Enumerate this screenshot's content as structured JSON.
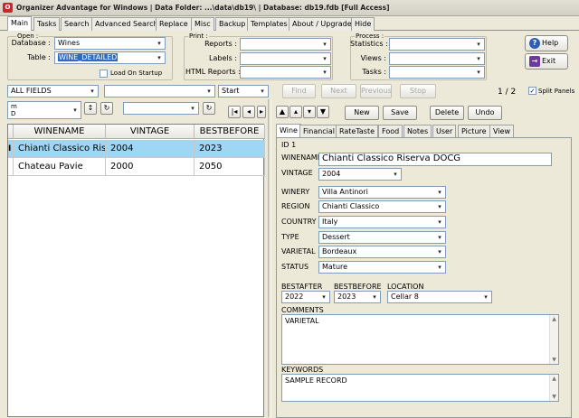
{
  "window": {
    "title": "Organizer Advantage for Windows | Data Folder: ...\\data\\db19\\ | Database: db19.fdb [Full Access]"
  },
  "main_tabs": [
    "Main",
    "Tasks",
    "Search",
    "Advanced Search",
    "Replace",
    "Misc",
    "Backup",
    "Templates",
    "About / Upgrade",
    "Hide"
  ],
  "open_group": {
    "label": "Open :",
    "database_label": "Database :",
    "database_value": "Wines",
    "table_label": "Table :",
    "table_value": "WINE_DETAILED",
    "load_on_startup_label": "Load On Startup",
    "load_on_startup_checked": false
  },
  "print_group": {
    "label": "Print :",
    "reports_label": "Reports :",
    "labels_label": "Labels :",
    "html_reports_label": "HTML Reports :"
  },
  "process_group": {
    "label": "Process :",
    "statistics_label": "Statistics :",
    "views_label": "Views :",
    "tasks_label": "Tasks :"
  },
  "side_buttons": {
    "help": "Help",
    "exit": "Exit"
  },
  "search_bar": {
    "field": "ALL FIELDS",
    "value": "",
    "mode": "Start",
    "find": "Find",
    "next": "Next",
    "previous": "Previous",
    "stop": "Stop",
    "record_counter": "1 / 2",
    "split_panels_label": "Split Panels",
    "split_panels_checked": true
  },
  "sort_bar": {
    "sort_field_line1": "m",
    "sort_field_line2": "D"
  },
  "grid": {
    "columns": [
      "WINENAME",
      "VINTAGE",
      "BESTBEFORE"
    ],
    "row_indicator": "I",
    "rows": [
      [
        "Chianti Classico Riserva DOCG",
        "2004",
        "2023"
      ],
      [
        "Chateau Pavie",
        "2000",
        "2050"
      ]
    ],
    "selected_row": 0
  },
  "record_toolbar": {
    "nav_icons": [
      "first-icon",
      "prior-icon",
      "next-icon",
      "last-icon"
    ],
    "new": "New",
    "save": "Save",
    "delete": "Delete",
    "undo": "Undo"
  },
  "detail_tabs": [
    "Wine",
    "Financial",
    "RateTaste",
    "Food",
    "Notes",
    "User",
    "Picture",
    "View"
  ],
  "form": {
    "id_text": "ID 1",
    "winename_label": "WINENAME",
    "winename": "Chianti Classico Riserva DOCG",
    "vintage_label": "VINTAGE",
    "vintage": "2004",
    "winery_label": "WINERY",
    "winery": "Villa Antinori",
    "region_label": "REGION",
    "region": "Chianti Classico",
    "country_label": "COUNTRY",
    "country": "Italy",
    "type_label": "TYPE",
    "type": "Dessert",
    "varietal_label": "VARIETAL",
    "varietal": "Bordeaux",
    "status_label": "STATUS",
    "status": "Mature",
    "bestafter_label": "BESTAFTER",
    "bestafter": "2022",
    "bestbefore_label": "BESTBEFORE",
    "bestbefore": "2023",
    "location_label": "LOCATION",
    "location": "Cellar 8",
    "comments_label": "COMMENTS",
    "comments": "VARIETAL",
    "keywords_label": "KEYWORDS",
    "keywords": "SAMPLE RECORD"
  },
  "colors": {
    "selection_row": "#9fd6f4",
    "highlight": "#316ac5",
    "window_bg": "#ece9d8"
  }
}
